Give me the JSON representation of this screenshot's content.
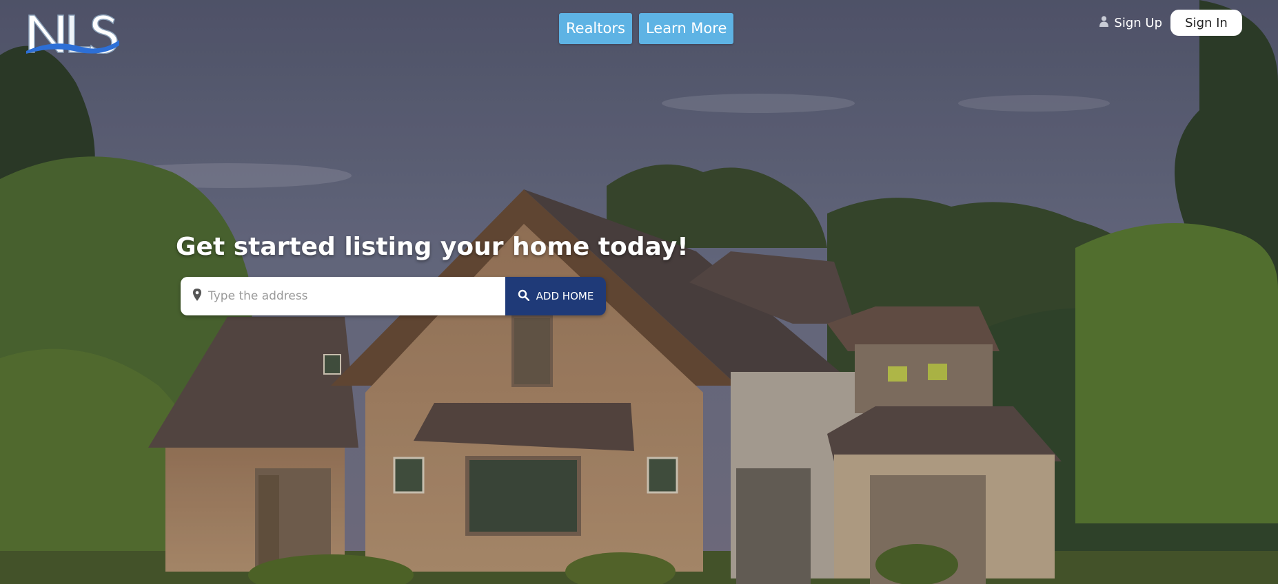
{
  "brand": {
    "logo_text": "NLS"
  },
  "nav": {
    "realtors_label": "Realtors",
    "learn_more_label": "Learn More"
  },
  "auth": {
    "sign_up_label": "Sign Up",
    "sign_in_label": "Sign In"
  },
  "hero": {
    "headline": "Get started listing your home today!",
    "search": {
      "placeholder": "Type the address",
      "value": "",
      "button_label": "ADD HOME"
    }
  },
  "colors": {
    "nav_button_bg": "#5eb3e4",
    "add_home_bg": "#1f3a78",
    "sky": "#5a5e72"
  },
  "icons": [
    "user-icon",
    "map-pin-icon",
    "search-icon"
  ]
}
